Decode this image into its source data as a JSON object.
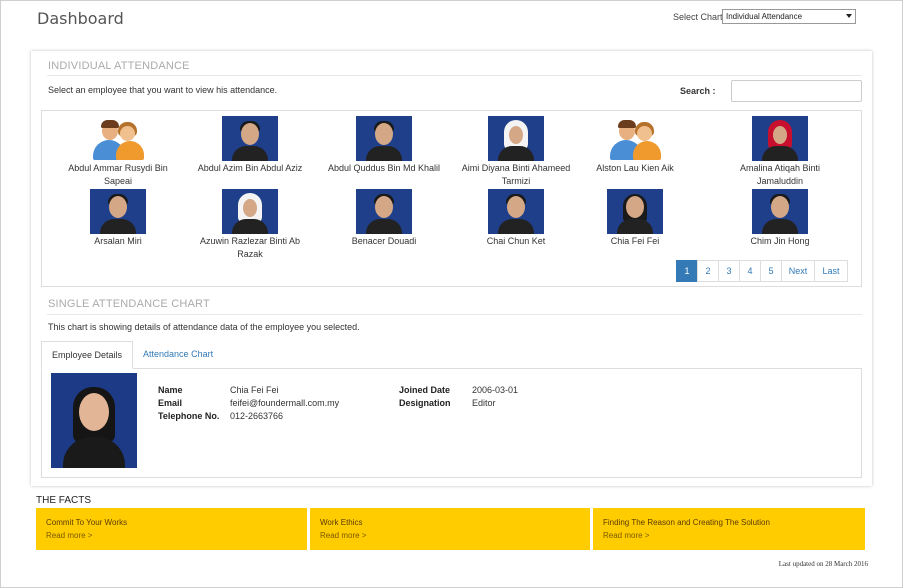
{
  "page": {
    "title": "Dashboard",
    "select_chart_label": "Select Chart",
    "select_chart_value": "Individual Attendance"
  },
  "individual": {
    "title": "INDIVIDUAL ATTENDANCE",
    "description": "Select an employee that you want to view his attendance.",
    "search_label": "Search :",
    "search_value": "",
    "employees": [
      {
        "name": "Abdul Ammar Rusydi Bin Sapeai",
        "photo": "placeholder-icon"
      },
      {
        "name": "Abdul Azim Bin Abdul Aziz",
        "photo": "photo"
      },
      {
        "name": "Abdul Quddus Bin Md Khalil",
        "photo": "photo"
      },
      {
        "name": "Aimi Diyana Binti Ahameed Tarmizi",
        "photo": "photo-hijab-white"
      },
      {
        "name": "Alston Lau Kien Aik",
        "photo": "placeholder-icon"
      },
      {
        "name": "Amalina Atiqah Binti Jamaluddin",
        "photo": "photo-hijab-red"
      },
      {
        "name": "Arsalan Miri",
        "photo": "photo"
      },
      {
        "name": "Azuwin Razlezar Binti Ab Razak",
        "photo": "photo-hijab-white"
      },
      {
        "name": "Benacer Douadi",
        "photo": "photo"
      },
      {
        "name": "Chai Chun Ket",
        "photo": "photo"
      },
      {
        "name": "Chia Fei Fei",
        "photo": "photo-longhair"
      },
      {
        "name": "Chim Jin Hong",
        "photo": "photo"
      }
    ],
    "pagination": [
      "1",
      "2",
      "3",
      "4",
      "5",
      "Next",
      "Last"
    ],
    "active_page": "1"
  },
  "single": {
    "title": "SINGLE ATTENDANCE CHART",
    "description": "This chart is showing details of attendance data of the employee you selected.",
    "tabs": [
      "Employee Details",
      "Attendance Chart"
    ],
    "active_tab": "Employee Details",
    "details": {
      "name_label": "Name",
      "name": "Chia Fei Fei",
      "email_label": "Email",
      "email": "feifei@foundermall.com.my",
      "phone_label": "Telephone No.",
      "phone": "012-2663766",
      "joined_label": "Joined Date",
      "joined": "2006-03-01",
      "designation_label": "Designation",
      "designation": "Editor"
    }
  },
  "facts": {
    "title": "THE FACTS",
    "items": [
      {
        "heading": "Commit To Your Works",
        "more": "Read more >"
      },
      {
        "heading": "Work Ethics",
        "more": "Read more >"
      },
      {
        "heading": "Finding The Reason and Creating The Solution",
        "more": "Read more >"
      }
    ],
    "color": "#ffcc00"
  },
  "footer": {
    "updated": "Last updated on 28 March 2016"
  },
  "colors": {
    "accent": "#337ab7",
    "section_title": "#aaaaaa"
  }
}
